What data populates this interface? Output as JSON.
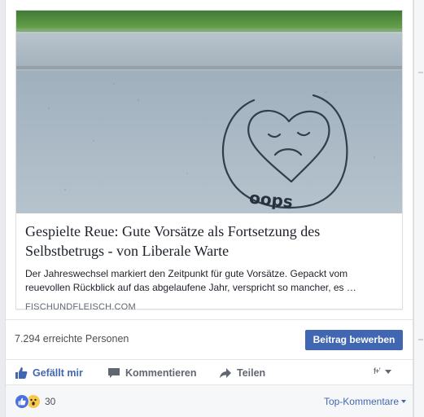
{
  "link_preview": {
    "title": "Gespielte Reue: Gute Vorsätze als Fortsetzung des Selbstbetrugs - von Liberale Warte",
    "description": "Der Jahreswechsel markiert den Zeitpunkt für gute Vorsätze. Gepackt vom reuevollen Rückblick auf das abgelaufene Jahr, verspricht so mancher, es …",
    "domain": "FISCHUNDFLEISCH.COM",
    "image_graffiti_text": "oops"
  },
  "insights": {
    "reach": "7.294 erreichte Personen",
    "promote_label": "Beitrag bewerben"
  },
  "actions": {
    "like": "Gefällt mir",
    "comment": "Kommentieren",
    "share": "Teilen",
    "audience_icon": "custom-audience-icon"
  },
  "reactions": {
    "count": "30",
    "types": [
      "like",
      "wow"
    ],
    "sort_label": "Top-Kommentare"
  },
  "colors": {
    "accent": "#4267b2",
    "like_active": "#4267b2",
    "secondary_text": "#606770"
  }
}
